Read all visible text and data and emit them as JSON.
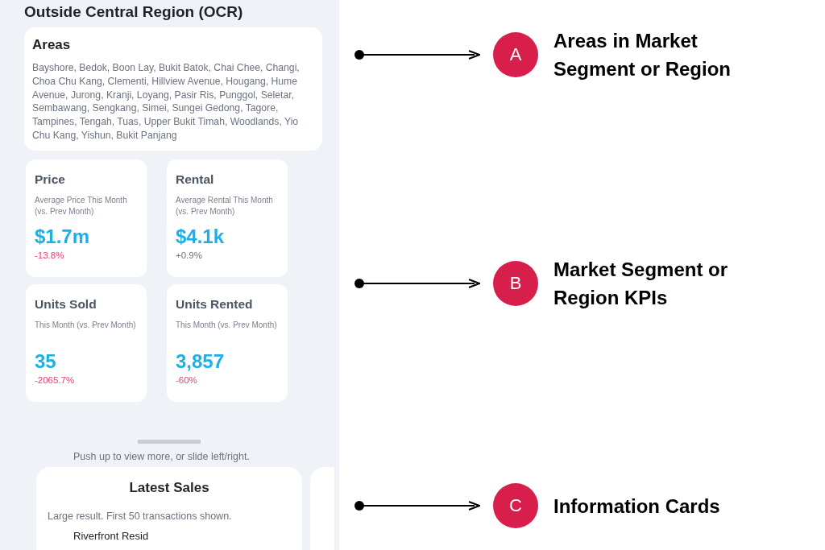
{
  "region_title": "Outside Central Region (OCR)",
  "areas": {
    "title": "Areas",
    "text": "Bayshore, Bedok, Boon Lay, Bukit Batok, Chai Chee, Changi, Choa Chu Kang, Clementi, Hillview Avenue, Hougang, Hume Avenue, Jurong, Kranji, Loyang, Pasir Ris, Punggol, Seletar, Sembawang, Sengkang, Simei, Sungei Gedong, Tagore, Tampines, Tengah, Tuas, Upper Bukit Timah, Woodlands, Yio Chu Kang, Yishun, Bukit Panjang"
  },
  "kpis": [
    {
      "title": "Price",
      "subtitle": "Average Price This Month (vs. Prev Month)",
      "value": "$1.7m",
      "change": "-13.8%",
      "color": "#e8416f"
    },
    {
      "title": "Rental",
      "subtitle": "Average Rental This Month (vs. Prev Month)",
      "value": "$4.1k",
      "change": "+0.9%",
      "color": "#6b7280"
    },
    {
      "title": "Units Sold",
      "subtitle": "This Month (vs. Prev Month)",
      "value": "35",
      "change": "-2065.7%",
      "color": "#e8416f"
    },
    {
      "title": "Units Rented",
      "subtitle": "This Month (vs. Prev Month)",
      "value": "3,857",
      "change": "-60%",
      "color": "#e8416f"
    }
  ],
  "hint": "Push up to view more, or slide left/right.",
  "sales_card": {
    "title": "Latest Sales",
    "note": "Large result. First 50 transactions shown.",
    "first_project": "Riverfront Resid"
  },
  "annotations": [
    {
      "letter": "A",
      "label": "Areas in Market Segment or Region"
    },
    {
      "letter": "B",
      "label": "Market Segment or Region KPIs"
    },
    {
      "letter": "C",
      "label": "Information Cards"
    }
  ]
}
